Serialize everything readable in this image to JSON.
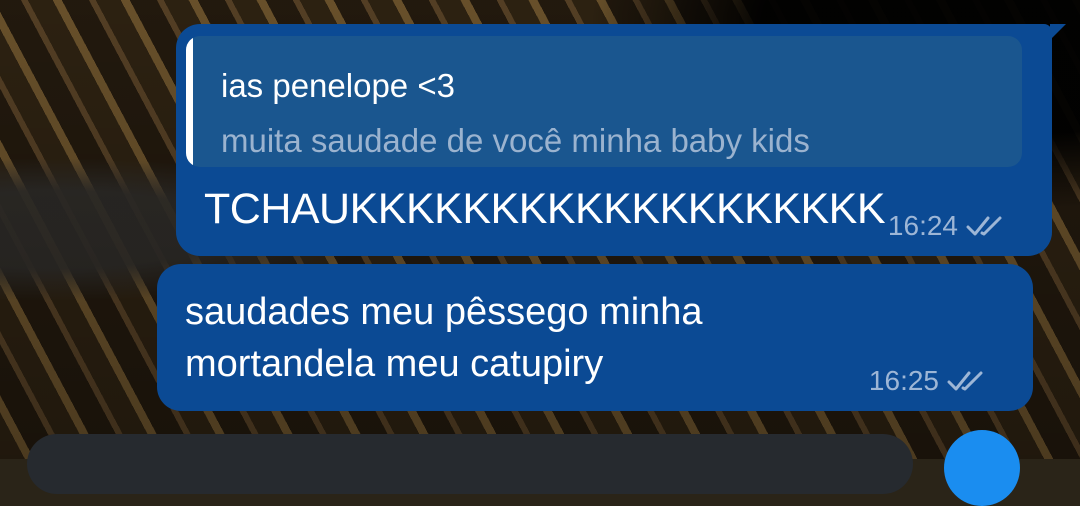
{
  "messages": [
    {
      "reply": {
        "author": "ias penelope <3",
        "text": "muita saudade de você minha baby kids"
      },
      "text": "TCHAUKKKKKKKKKKKKKKKKKKK",
      "time": "16:24",
      "status_icon": "double-check-icon"
    },
    {
      "text": "saudades meu pêssego minha mortandela meu catupiry",
      "time": "16:25",
      "status_icon": "double-check-icon"
    }
  ],
  "colors": {
    "bubble": "#0b4a94",
    "quote_bg": "#1a568f",
    "send_button": "#1a8df0"
  }
}
